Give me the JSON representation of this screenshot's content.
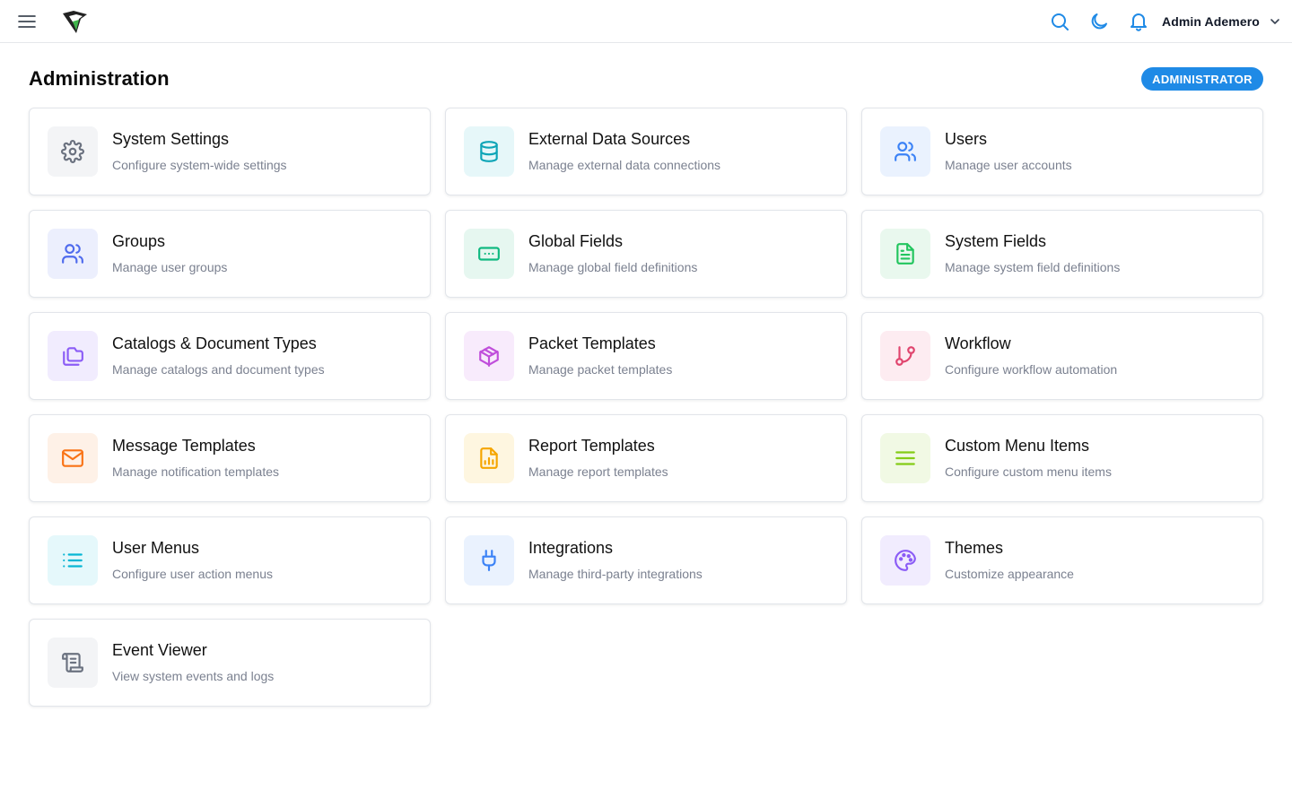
{
  "header": {
    "user_name": "Admin Ademero",
    "menu_icon": "hamburger-menu-icon",
    "logo_icon": "ademero-logo-icon",
    "search_icon": "search-icon",
    "theme_icon": "moon-icon",
    "notifications_icon": "bell-icon",
    "accent_color": "#1f8ae6"
  },
  "page": {
    "title": "Administration",
    "role_badge": "ADMINISTRATOR"
  },
  "cards": [
    {
      "title": "System Settings",
      "description": "Configure system-wide settings",
      "icon": "gear-icon",
      "color": "#6b7280",
      "bg": "#f3f4f6"
    },
    {
      "title": "External Data Sources",
      "description": "Manage external data connections",
      "icon": "database-icon",
      "color": "#0ea5b7",
      "bg": "#e6f7f9"
    },
    {
      "title": "Users",
      "description": "Manage user accounts",
      "icon": "users-icon",
      "color": "#3b82f6",
      "bg": "#eaf2fe"
    },
    {
      "title": "Groups",
      "description": "Manage user groups",
      "icon": "users-icon",
      "color": "#4f6bed",
      "bg": "#eceffd"
    },
    {
      "title": "Global Fields",
      "description": "Manage global field definitions",
      "icon": "input-field-icon",
      "color": "#10b981",
      "bg": "#e6f7f0"
    },
    {
      "title": "System Fields",
      "description": "Manage system field definitions",
      "icon": "document-icon",
      "color": "#22c55e",
      "bg": "#e9f8ee"
    },
    {
      "title": "Catalogs & Document Types",
      "description": "Manage catalogs and document types",
      "icon": "folders-icon",
      "color": "#8b5cf6",
      "bg": "#f1ecfe"
    },
    {
      "title": "Packet Templates",
      "description": "Manage packet templates",
      "icon": "package-icon",
      "color": "#c04fdb",
      "bg": "#f8ebfc"
    },
    {
      "title": "Workflow",
      "description": "Configure workflow automation",
      "icon": "git-branch-icon",
      "color": "#e0456e",
      "bg": "#fdecf1"
    },
    {
      "title": "Message Templates",
      "description": "Manage notification templates",
      "icon": "mail-icon",
      "color": "#f97316",
      "bg": "#fef1e7"
    },
    {
      "title": "Report Templates",
      "description": "Manage report templates",
      "icon": "report-icon",
      "color": "#f5a500",
      "bg": "#fef6e0"
    },
    {
      "title": "Custom Menu Items",
      "description": "Configure custom menu items",
      "icon": "menu-lines-icon",
      "color": "#84cc16",
      "bg": "#f1f9e4"
    },
    {
      "title": "User Menus",
      "description": "Configure user action menus",
      "icon": "list-icon",
      "color": "#06b6d4",
      "bg": "#e5f8fb"
    },
    {
      "title": "Integrations",
      "description": "Manage third-party integrations",
      "icon": "plug-icon",
      "color": "#3b82f6",
      "bg": "#eaf2fe"
    },
    {
      "title": "Themes",
      "description": "Customize appearance",
      "icon": "palette-icon",
      "color": "#8b5cf6",
      "bg": "#f1ecfe"
    },
    {
      "title": "Event Viewer",
      "description": "View system events and logs",
      "icon": "scroll-icon",
      "color": "#6b7280",
      "bg": "#f3f4f6"
    }
  ]
}
